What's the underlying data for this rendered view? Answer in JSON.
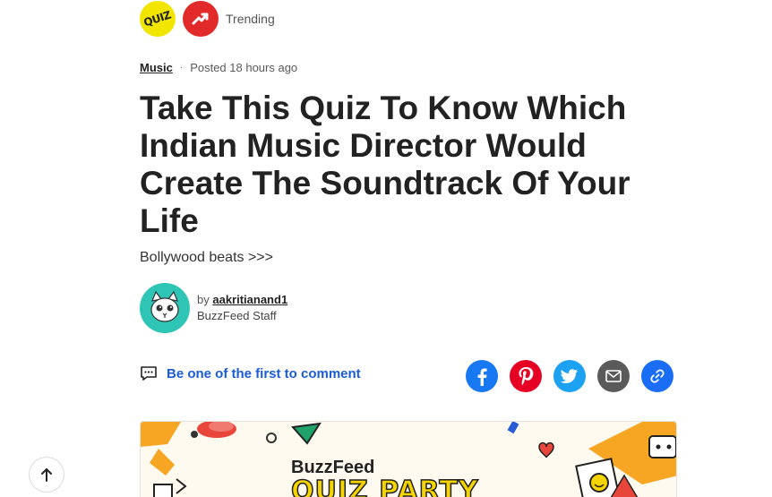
{
  "topbar": {
    "quiz_badge": "QUIZ",
    "trending_icon": "trending-up-icon",
    "trending_label": "Trending"
  },
  "meta": {
    "category": "Music",
    "separator": "·",
    "posted": "Posted 18 hours ago"
  },
  "article": {
    "title": "Take This Quiz To Know Which Indian Music Director Would Create The Soundtrack Of Your Life",
    "subtitle": "Bollywood beats >>>"
  },
  "author": {
    "by_label": "by",
    "name": "aakritianand1",
    "role": "BuzzFeed Staff"
  },
  "comments": {
    "icon": "comment-icon",
    "label": "Be one of the first to comment"
  },
  "share": [
    {
      "icon": "facebook-icon",
      "color": "#1877f2"
    },
    {
      "icon": "pinterest-icon",
      "color": "#e60023"
    },
    {
      "icon": "twitter-icon",
      "color": "#1da1f2"
    },
    {
      "icon": "email-icon",
      "color": "#5a5a5a"
    },
    {
      "icon": "link-icon",
      "color": "#1a6ef5"
    }
  ],
  "hero": {
    "brand": "BuzzFeed",
    "headline": "QUIZ PARTY"
  },
  "scroll_top_icon": "arrow-up-icon",
  "colors": {
    "accent": "#1a5cd8",
    "quiz_yellow": "#f2e600",
    "trending_red": "#e32a2a",
    "avatar_teal": "#2ec4b6"
  }
}
